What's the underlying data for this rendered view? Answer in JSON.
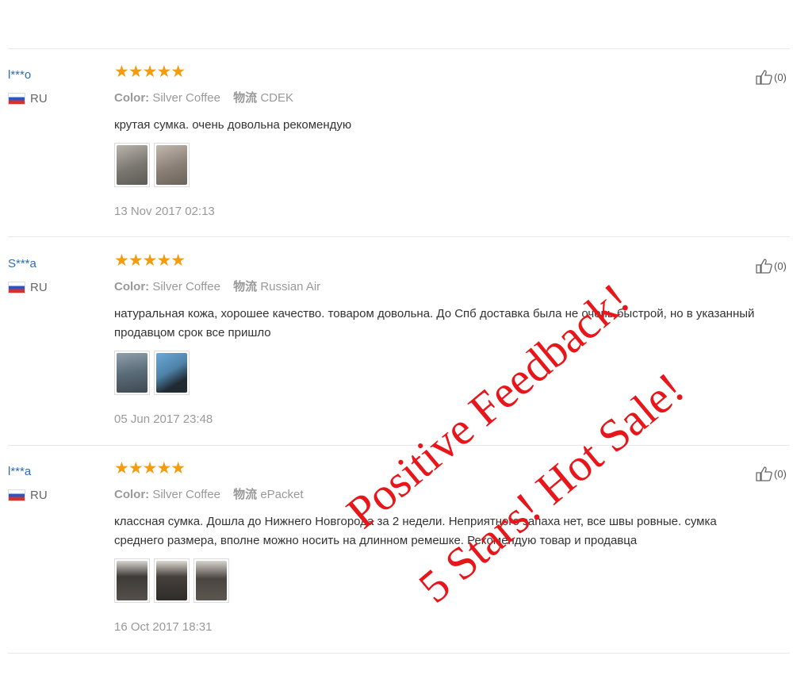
{
  "like_icon": "thumbs-up-icon",
  "reviews": [
    {
      "user": "l***o",
      "country": "RU",
      "stars": "★★★★★",
      "color_label": "Color:",
      "color_value": "Silver Coffee",
      "shipping_label": "物流",
      "shipping_value": "CDEK",
      "text": "крутая сумка. очень довольна рекомендую",
      "photo_colors": [
        "#7a7670",
        "#8a7f76"
      ],
      "date": "13 Nov 2017 02:13",
      "likes": "(0)"
    },
    {
      "user": "S***a",
      "country": "RU",
      "stars": "★★★★★",
      "color_label": "Color:",
      "color_value": "Silver Coffee",
      "shipping_label": "物流",
      "shipping_value": "Russian Air",
      "text": "натуральная кожа, хорошее качество. товаром довольна. До Спб доставка была не очень быстрой, но в указанный продавцом срок все пришло",
      "photo_colors": [
        "#5a6b78",
        "#4e82a8"
      ],
      "date": "05 Jun 2017 23:48",
      "likes": "(0)"
    },
    {
      "user": "l***a",
      "country": "RU",
      "stars": "★★★★★",
      "color_label": "Color:",
      "color_value": "Silver Coffee",
      "shipping_label": "物流",
      "shipping_value": "ePacket",
      "text": "классная сумка. Дошла до Нижнего Новгорода за 2 недели. Неприятного запаха нет, все швы ровные. сумка среднего размера, вполне можно носить на длинном ремешке. Рекомендую товар и продавца",
      "photo_colors": [
        "#3d3a38",
        "#45403b",
        "#4a4541"
      ],
      "date": "16 Oct 2017 18:31",
      "likes": "(0)"
    }
  ],
  "promo": {
    "line1": "Positive Feedback!",
    "line2": "5 Stars! Hot Sale!",
    "color": "#e8161b"
  }
}
